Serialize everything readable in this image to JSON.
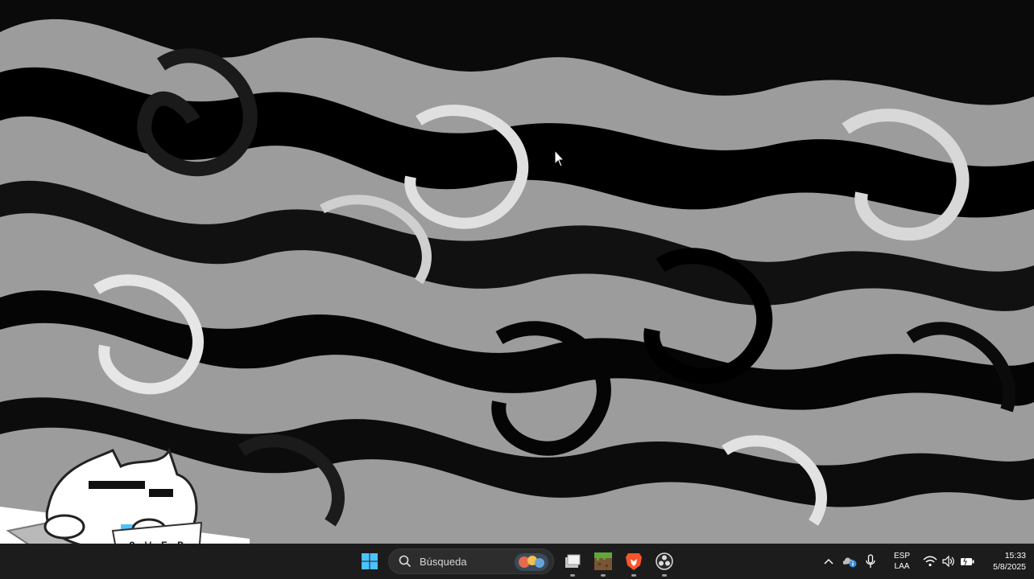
{
  "desktop": {
    "wallpaper_description_icon": "abstract-marble-swirl-wallpaper",
    "cursor_icon": "arrow-cursor-icon",
    "overlay_icon": "cat-typing-keyboard-sticker",
    "overlay_keyboard_keys": [
      "Q",
      "W",
      "E",
      "R",
      "A",
      "S",
      "D"
    ]
  },
  "taskbar": {
    "background": "#1c1c1c",
    "start_icon": "windows-start-icon",
    "search": {
      "placeholder": "Búsqueda",
      "icon": "search-icon"
    },
    "apps": [
      {
        "name": "file-explorer",
        "icon": "file-explorer-icon",
        "running": true
      },
      {
        "name": "minecraft",
        "icon": "minecraft-icon",
        "running": true
      },
      {
        "name": "brave",
        "icon": "brave-browser-icon",
        "running": true
      },
      {
        "name": "obs",
        "icon": "obs-studio-icon",
        "running": true
      }
    ],
    "tray": {
      "chevron_icon": "chevron-up-icon",
      "cloud_icon": "cloud-info-icon",
      "mic_icon": "microphone-icon",
      "language_primary": "ESP",
      "language_secondary": "LAA",
      "wifi_icon": "wifi-icon",
      "volume_icon": "volume-icon",
      "battery_icon": "battery-icon",
      "time": "15:33",
      "date": "5/8/2025"
    }
  }
}
